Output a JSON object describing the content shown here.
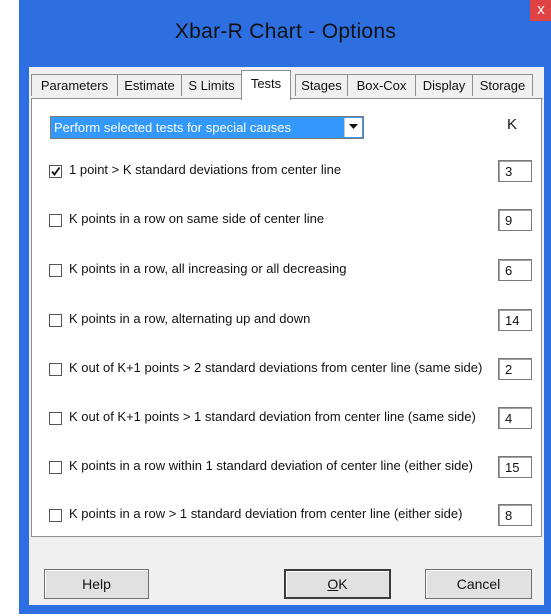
{
  "window": {
    "title": "Xbar-R Chart - Options",
    "close_glyph": "x",
    "titlebar_color": "#2d6fe0",
    "close_color": "#e04343"
  },
  "tabs": [
    {
      "label": "Parameters",
      "active": false
    },
    {
      "label": "Estimate",
      "active": false
    },
    {
      "label": "S Limits",
      "active": false
    },
    {
      "label": "Tests",
      "active": true
    },
    {
      "label": "Stages",
      "active": false
    },
    {
      "label": "Box-Cox",
      "active": false
    },
    {
      "label": "Display",
      "active": false
    },
    {
      "label": "Storage",
      "active": false
    }
  ],
  "tests_panel": {
    "mode_select": {
      "selected": "Perform selected tests for special causes",
      "highlight_color": "#3399ff"
    },
    "k_header": "K",
    "tests": [
      {
        "label": "1 point > K standard deviations from center line",
        "checked": true,
        "k": "3"
      },
      {
        "label": "K points in a row on same side of center line",
        "checked": false,
        "k": "9"
      },
      {
        "label": "K points in a row, all increasing or all decreasing",
        "checked": false,
        "k": "6"
      },
      {
        "label": "K points in a row, alternating up and down",
        "checked": false,
        "k": "14"
      },
      {
        "label": "K out of K+1 points > 2 standard deviations from center line (same side)",
        "checked": false,
        "k": "2"
      },
      {
        "label": "K out of K+1 points > 1 standard deviation from center line (same side)",
        "checked": false,
        "k": "4"
      },
      {
        "label": "K points in a row within 1 standard deviation of center line (either side)",
        "checked": false,
        "k": "15"
      },
      {
        "label": "K points in a row > 1 standard deviation from center line (either side)",
        "checked": false,
        "k": "8"
      }
    ]
  },
  "buttons": {
    "help": "Help",
    "ok_mnemonic": "O",
    "ok_rest": "K",
    "cancel": "Cancel"
  }
}
